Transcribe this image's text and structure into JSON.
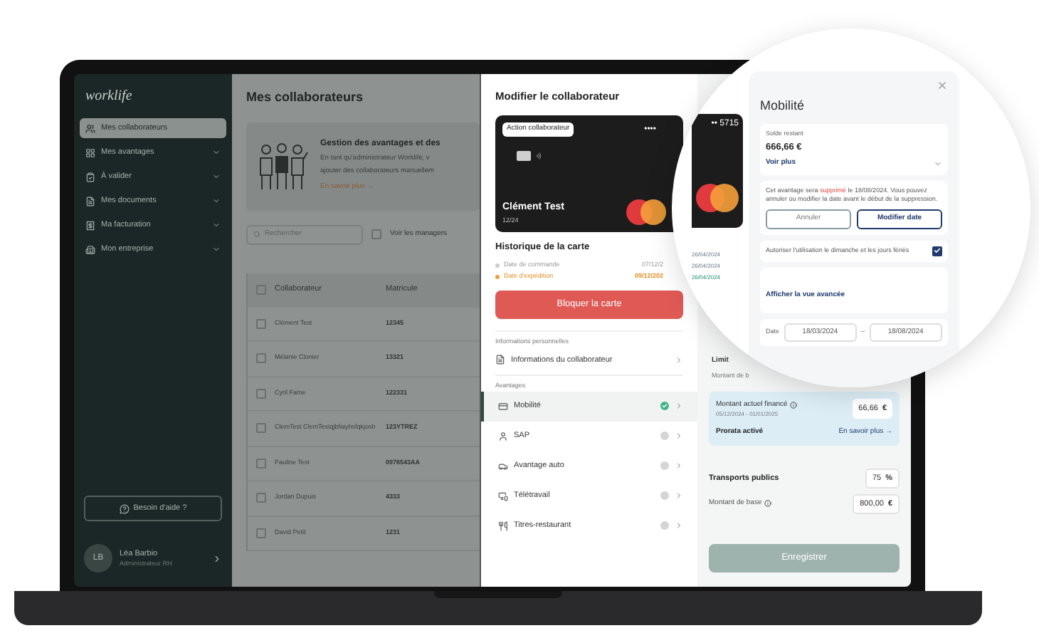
{
  "sidebar": {
    "logo": "worklife",
    "items": [
      {
        "label": "Mes collaborateurs",
        "selected": true,
        "expandable": false
      },
      {
        "label": "Mes avantages",
        "selected": false,
        "expandable": true
      },
      {
        "label": "À valider",
        "selected": false,
        "expandable": true
      },
      {
        "label": "Mes documents",
        "selected": false,
        "expandable": true
      },
      {
        "label": "Ma facturation",
        "selected": false,
        "expandable": true
      },
      {
        "label": "Mon entreprise",
        "selected": false,
        "expandable": true
      }
    ],
    "help_button": "Besoin d'aide ?",
    "user": {
      "initials": "LB",
      "name": "Léa Barbio",
      "role": "Administrateur RH"
    }
  },
  "main": {
    "title": "Mes collaborateurs",
    "banner": {
      "title": "Gestion des avantages et des",
      "lines": [
        "En tant qu'administrateur Worklife, v",
        "ajouter des collaborateurs manuellem"
      ],
      "link": "En savoir plus →"
    },
    "search": {
      "placeholder": "Rechercher"
    },
    "managers_filter": {
      "label": "Voir les managers",
      "checked": false
    },
    "table": {
      "header_checked": false,
      "columns": [
        "Collaborateur",
        "Matricule"
      ],
      "rows": [
        {
          "name": "Clément Test",
          "id": "12345",
          "checked": false
        },
        {
          "name": "Mélanie Clonier",
          "id": "13321",
          "checked": false
        },
        {
          "name": "Cyril Fame",
          "id": "122331",
          "checked": false
        },
        {
          "name": "ClemTest ClemTestqjbfaiyhsfqkjosh",
          "id": "123YTREZ",
          "checked": false
        },
        {
          "name": "Pauline Test",
          "id": "0976543AA",
          "checked": false
        },
        {
          "name": "Jordan Dupuis",
          "id": "4333",
          "checked": false
        },
        {
          "name": "David Petit",
          "id": "1231",
          "checked": false
        }
      ]
    }
  },
  "edit_panel": {
    "title": "Modifier le collaborateur",
    "card": {
      "badge": "Action collaborateur",
      "dots": "••••",
      "holder": "Clément Test",
      "expiry": "12/24"
    },
    "history": {
      "title": "Historique de la carte",
      "events": [
        {
          "label": "Date de commande",
          "date": "07/12/2",
          "active": false
        },
        {
          "label": "Date d'expédition",
          "date": "09/12/202",
          "active": true
        }
      ]
    },
    "block_button": "Bloquer la carte",
    "personal_section": "Informations personnelles",
    "personal_item": "Informations du collaborateur",
    "benefits_section": "Avantages",
    "benefits": [
      {
        "label": "Mobilité",
        "active": true,
        "selected": true
      },
      {
        "label": "SAP",
        "active": false,
        "selected": false
      },
      {
        "label": "Avantage auto",
        "active": false,
        "selected": false
      },
      {
        "label": "Télétravail",
        "active": false,
        "selected": false
      },
      {
        "label": "Titres-restaurant",
        "active": false,
        "selected": false
      }
    ]
  },
  "right_panel": {
    "limit_label": "Limit",
    "base_label_cut": "Montant de b",
    "financed": {
      "label": "Montant actuel financé",
      "period": "05/12/2024 - 01/01/2025",
      "value": "66,66",
      "unit": "€",
      "prorata": "Prorata activé",
      "link": "En savoir plus →"
    },
    "transport": {
      "label": "Transports publics",
      "value": "75",
      "unit": "%"
    },
    "base": {
      "label": "Montant de base",
      "value": "800,00",
      "unit": "€"
    },
    "save_button": "Enregistrer"
  },
  "magnifier": {
    "card_number": "•• 5715",
    "dates": [
      "26/04/2024",
      "26/04/2024",
      "26/04/2024"
    ],
    "title": "Mobilité",
    "balance_label": "Solde restant",
    "balance": "666,66 €",
    "more": "Voir plus",
    "notice": {
      "before": "Cet avantage sera ",
      "highlight": "supprimé",
      "after": " le 18/08/2024. Vous pouvez annuler ou modifier la date avant le début de la suppression."
    },
    "cancel_button": "Annuler",
    "modify_button": "Modifier date",
    "sunday": {
      "label": "Autoriser l'utilisation le dimanche et les jours fériés",
      "checked": true
    },
    "advanced_link": "Afficher la vue avancée",
    "date": {
      "label": "Date",
      "from": "18/03/2024",
      "sep": "–",
      "to": "18/08/2024"
    }
  }
}
